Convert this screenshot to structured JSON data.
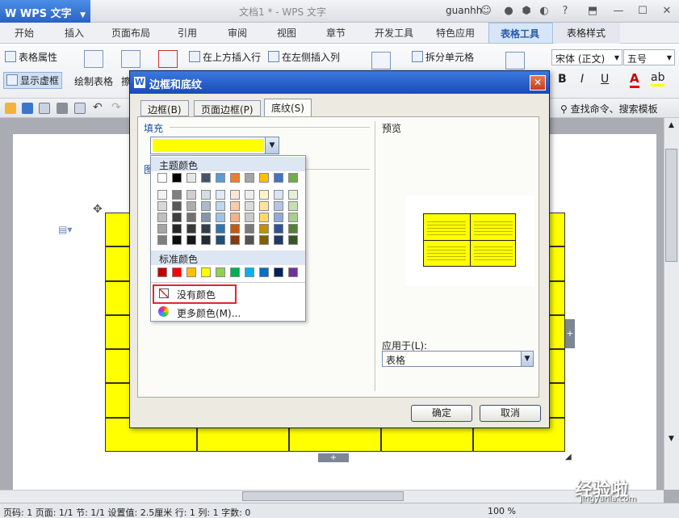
{
  "app": {
    "brand": "WPS 文字",
    "doc_title": "文档1 * - WPS 文字",
    "user": "guanhh"
  },
  "tabs": [
    "开始",
    "插入",
    "页面布局",
    "引用",
    "审阅",
    "视图",
    "章节",
    "开发工具",
    "特色应用",
    "表格工具",
    "表格样式"
  ],
  "ribbon": {
    "table_props": "表格属性",
    "show_gridlines": "显示虚框",
    "draw_table": "绘制表格",
    "erase_partial": "擦",
    "insert_above": "在上方插入行",
    "insert_left": "在左侧插入列",
    "split_cells": "拆分单元格",
    "font_name": "宋体 (正文)",
    "font_size": "五号",
    "bold": "B",
    "italic": "I",
    "underline": "U"
  },
  "quickbar": {
    "search": "查找命令、搜索模板"
  },
  "dialog": {
    "title": "边框和底纹",
    "close": "✕",
    "tabs": [
      "边框(B)",
      "页面边框(P)",
      "底纹(S)"
    ],
    "fill_label": "填充",
    "pattern_label": "图",
    "preview_label": "预览",
    "apply_label": "应用于(L):",
    "apply_value": "表格",
    "ok": "确定",
    "cancel": "取消"
  },
  "color_popup": {
    "theme_label": "主题颜色",
    "standard_label": "标准颜色",
    "no_color": "没有颜色",
    "more_colors": "更多颜色(M)...",
    "theme_top": [
      "#ffffff",
      "#000000",
      "#e7e6e6",
      "#44546a",
      "#5b9bd5",
      "#ed7d31",
      "#a5a5a5",
      "#ffc000",
      "#4472c4",
      "#70ad47"
    ],
    "shade_rows": [
      [
        "#f2f2f2",
        "#7f7f7f",
        "#d0cece",
        "#d6dce4",
        "#deebf6",
        "#fbe5d5",
        "#ededed",
        "#fff2cc",
        "#dae3f3",
        "#e2efd9"
      ],
      [
        "#d8d8d8",
        "#595959",
        "#aeabab",
        "#adb9ca",
        "#bdd7ee",
        "#f7cbac",
        "#dbdbdb",
        "#fee599",
        "#b4c6e7",
        "#c5e0b3"
      ],
      [
        "#bfbfbf",
        "#3f3f3f",
        "#757070",
        "#8496b0",
        "#9dc3e6",
        "#f4b183",
        "#c9c9c9",
        "#ffd965",
        "#8eaadb",
        "#a8d08d"
      ],
      [
        "#a5a5a5",
        "#262626",
        "#3a3838",
        "#323f4f",
        "#2e75b5",
        "#c55a11",
        "#7b7b7b",
        "#bf9000",
        "#2f5496",
        "#538135"
      ],
      [
        "#7f7f7f",
        "#0c0c0c",
        "#171616",
        "#222a35",
        "#1e4e79",
        "#843c0b",
        "#525252",
        "#7f6000",
        "#1f3864",
        "#375623"
      ]
    ],
    "standard": [
      "#c00000",
      "#ff0000",
      "#ffc000",
      "#ffff00",
      "#92d050",
      "#00b050",
      "#00b0f0",
      "#0070c0",
      "#002060",
      "#7030a0"
    ]
  },
  "status": {
    "page": "页码: 1",
    "pages": "页面: 1/1",
    "section": "节: 1/1",
    "setting": "设置值: 2.5厘米",
    "row": "行: 1",
    "col": "列: 1",
    "words": "字数: 0",
    "zoom": "100 %"
  },
  "watermark": {
    "text": "经验啦",
    "url": "jingyanla.com"
  }
}
